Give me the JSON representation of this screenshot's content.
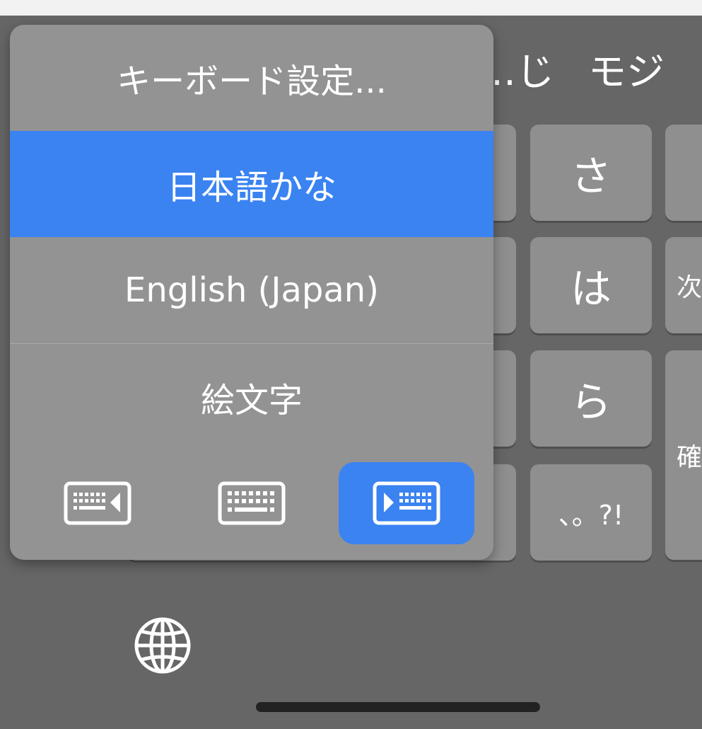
{
  "candidates": [
    "…じ",
    "モジ"
  ],
  "keys": {
    "sa": "さ",
    "ha": "は",
    "ra": "ら",
    "punct": "、。?!",
    "next": "次",
    "confirm": "確"
  },
  "popup": {
    "items": [
      {
        "label": "キーボード設定...",
        "selected": false
      },
      {
        "label": "日本語かな",
        "selected": true
      },
      {
        "label": "English (Japan)",
        "selected": false
      },
      {
        "label": "絵文字",
        "selected": false
      }
    ],
    "layout_buttons": [
      {
        "icon": "keyboard-left-icon",
        "selected": false
      },
      {
        "icon": "keyboard-icon",
        "selected": false
      },
      {
        "icon": "keyboard-right-icon",
        "selected": true
      }
    ]
  },
  "icons": {
    "globe": "globe-icon"
  },
  "colors": {
    "accent": "#3a83f1",
    "popup_bg": "#939393",
    "key_bg": "#8f8f8f",
    "keyboard_bg": "#666666"
  }
}
